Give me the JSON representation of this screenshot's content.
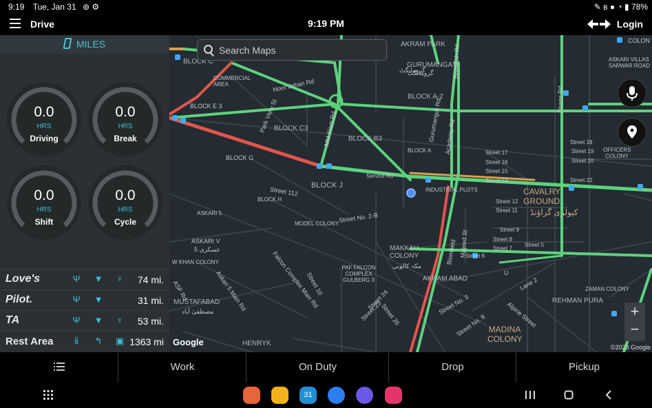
{
  "status_bar": {
    "time": "9:19",
    "date": "Tue, Jan 31",
    "battery": "78%"
  },
  "app_bar": {
    "title": "Drive",
    "clock": "9:19 PM",
    "login_label": "Login"
  },
  "panel": {
    "unit_label": "MILES",
    "gauges": [
      {
        "value": "0.0",
        "unit": "HRS",
        "label": "Driving"
      },
      {
        "value": "0.0",
        "unit": "HRS",
        "label": "Break"
      },
      {
        "value": "0.0",
        "unit": "HRS",
        "label": "Shift"
      },
      {
        "value": "0.0",
        "unit": "HRS",
        "label": "Cycle"
      }
    ],
    "stops": [
      {
        "brand": "Love's",
        "distance": "74 mi.",
        "icons": [
          "food-icon",
          "shower-icon",
          "fuel-pump-icon"
        ]
      },
      {
        "brand": "Pilot.",
        "distance": "31 mi.",
        "icons": [
          "food-icon",
          "shower-icon"
        ]
      },
      {
        "brand": "TA",
        "distance": "53 mi.",
        "icons": [
          "food-icon",
          "shower-icon",
          "fuel-pump-icon"
        ]
      },
      {
        "brand": "Rest Area",
        "distance": "1363 mi",
        "icons": [
          "restroom-icon",
          "turn-icon",
          "vending-icon"
        ]
      }
    ]
  },
  "map": {
    "search_placeholder": "Search Maps",
    "labels": {
      "l01": "BLOCK C",
      "l02": "AKRAM PARK",
      "l03": "GURUMANGAT",
      "l04": "گرومانگٹ",
      "l05": "COMMERCIAL AREA",
      "l06": "Noor Jehan Rd",
      "l07": "BLOCK E 3",
      "l08": "BLOCK C3",
      "l09": "BLOCK A-2",
      "l10": "BLOCK B3",
      "l11": "BLOCK G",
      "l12": "BLOCK J",
      "l13": "Service Rd",
      "l14": "INDUSTRIAL PLOTS",
      "l15": "Street 112",
      "l16": "BLOCK H",
      "l17": "ASKARI 5",
      "l18": "MODEL COLONY",
      "l19": "Street No. 2-B",
      "l20": "ASKARI V",
      "l21": "عسکری 5",
      "l22": "W KHAN COLONY",
      "l23": "Askari 5 Main Rd",
      "l24": "Falcon Complex Main Rd",
      "l25": "Street 10",
      "l26": "PAF FALCON COMPLEX GULBERG 3",
      "l27": "MAKKAH COLONY",
      "l28": "مکہ کالونی",
      "l29": "AKRAM ABAD",
      "l30": "MUSTAFABAD",
      "l31": "مصطفیٰ آباد",
      "l32": "HENRYK",
      "l33": "Street 26",
      "l34": "Street 24",
      "l35": "Street 23",
      "l36": "Street No. 3",
      "l37": "Street No. 8",
      "l38": "MADINA COLONY",
      "l39": "Alpine Street",
      "l40": "REHMAN PURA",
      "l41": "ZAMAN COLONY",
      "l42": "Lane 2",
      "l43": "CAVALRY GROUND",
      "l44": "کیولری گراؤنڈ",
      "l45": "Street 17",
      "l46": "Street 16",
      "l47": "Street 15",
      "l48": "Street 14",
      "l49": "Street 12",
      "l50": "Street 11",
      "l51": "Street 9",
      "l52": "Street 8",
      "l53": "Street 7",
      "l54": "Street 5",
      "l55": "Street 18",
      "l56": "Street 19",
      "l57": "Street 20",
      "l58": "Street 22",
      "l59": "OFFICERS COLONY",
      "l60": "ASKARI VILLAS SARWAR ROAD",
      "l61": "COLON",
      "l62": "Shami Rd",
      "l63": "Gurumangat Rd",
      "l64": "Academy Rd",
      "l65": "Park View St",
      "l66": "MM Alam Rd",
      "l67": "Blomfield",
      "l68": "Majeed St",
      "l69": "ASF Rd",
      "l70": "Street 6",
      "l71": "Bismillah Rd",
      "l72": "گرومانگٹ",
      "l73": "BLOCK A",
      "l74": "U"
    },
    "google_text": "Google",
    "copyright": "©2023 Google"
  },
  "tab_bar": {
    "work": "Work",
    "on_duty": "On Duty",
    "drop": "Drop",
    "pickup": "Pickup"
  },
  "colors": {
    "accent": "#4fc3d8",
    "traffic_green": "#5ed27c",
    "traffic_red": "#e4554b",
    "map_bg": "#242b32"
  }
}
